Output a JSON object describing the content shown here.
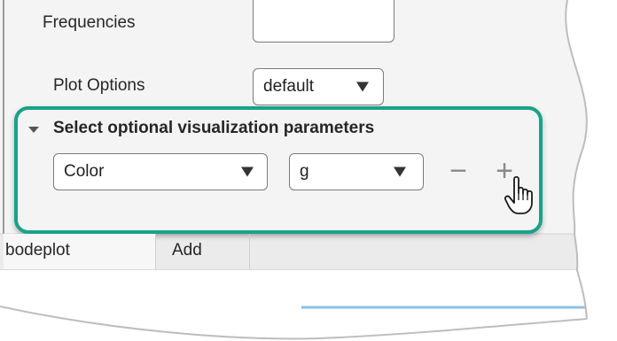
{
  "params": {
    "frequencies_label": "Frequencies",
    "plot_options_label": "Plot Options",
    "plot_options_value": "default"
  },
  "section": {
    "title": "Select optional visualization parameters",
    "parameter_name": "Color",
    "parameter_value": "g",
    "remove_label": "−",
    "add_label": "+"
  },
  "tabs": [
    {
      "label": "bodeplot"
    },
    {
      "label": "Add"
    }
  ],
  "colors": {
    "highlight": "#1aa288",
    "panel_background": "#f4f4f4",
    "tab_background": "#ebebeb"
  },
  "icons": {
    "expand": "caret-down-icon",
    "dropdown": "chevron-down-icon",
    "cursor": "hand-pointer-icon"
  }
}
